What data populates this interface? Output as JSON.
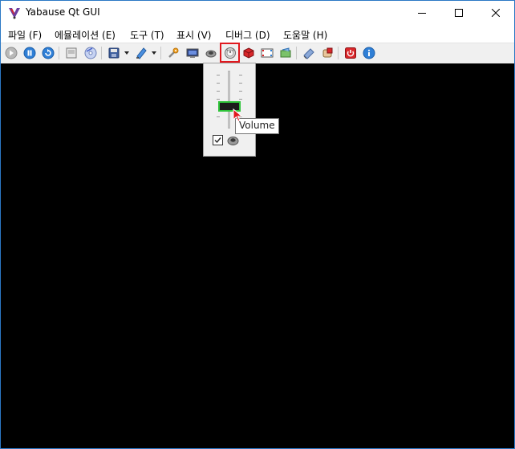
{
  "window": {
    "title": "Yabause Qt GUI"
  },
  "menu": {
    "items": [
      {
        "label": "파일 (F)"
      },
      {
        "label": "에뮬레이션 (E)"
      },
      {
        "label": "도구 (T)"
      },
      {
        "label": "표시 (V)"
      },
      {
        "label": "디버그 (D)"
      },
      {
        "label": "도움말 (H)"
      }
    ]
  },
  "toolbar": {
    "icons": [
      "play-icon",
      "pause-icon",
      "reset-icon",
      "open-iso-icon",
      "open-cd-icon",
      "save-state-icon",
      "load-state-icon",
      "settings-icon",
      "screenshot-icon",
      "frame-skip-icon",
      "volume-icon",
      "cheats-icon",
      "fullscreen-icon",
      "transfer-icon",
      "memory-editor-icon",
      "power-icon",
      "about-icon"
    ],
    "active": "volume-icon"
  },
  "volume_popup": {
    "level": 0.35,
    "mute_checked": true,
    "tooltip": "Volume"
  },
  "colors": {
    "highlight": "#e0191f",
    "slider_focus": "#2fc43a",
    "viewport": "#000000"
  }
}
